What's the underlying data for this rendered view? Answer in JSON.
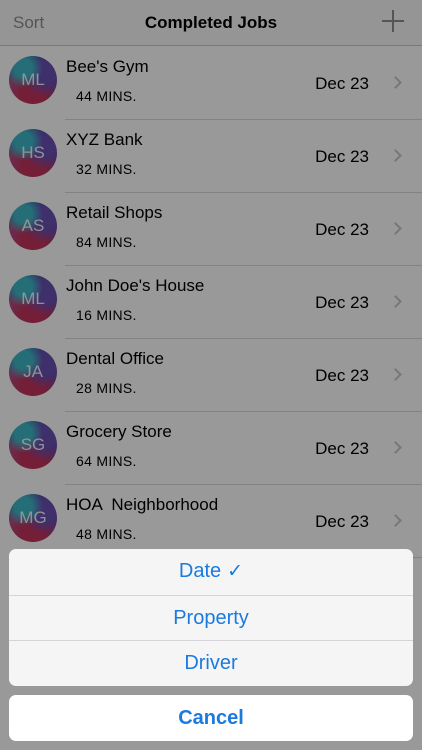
{
  "navbar": {
    "sort_label": "Sort",
    "title": "Completed Jobs",
    "add_icon": "plus-icon"
  },
  "jobs": [
    {
      "initials": "ML",
      "name": "Bee's Gym",
      "duration": "44 MINS.",
      "date": "Dec 23"
    },
    {
      "initials": "HS",
      "name": "XYZ Bank",
      "duration": "32 MINS.",
      "date": "Dec 23"
    },
    {
      "initials": "AS",
      "name": "Retail Shops",
      "duration": "84 MINS.",
      "date": "Dec 23"
    },
    {
      "initials": "ML",
      "name": "John Doe's House",
      "duration": "16 MINS.",
      "date": "Dec 23"
    },
    {
      "initials": "JA",
      "name": "Dental Office",
      "duration": "28 MINS.",
      "date": "Dec 23"
    },
    {
      "initials": "SG",
      "name": "Grocery Store",
      "duration": "64 MINS.",
      "date": "Dec 23"
    },
    {
      "initials": "MG",
      "name": "HOA  Neighborhood",
      "duration": "48 MINS.",
      "date": "Dec 23"
    }
  ],
  "sort_sheet": {
    "options": [
      {
        "label": "Date",
        "check": "✓"
      },
      {
        "label": "Property"
      },
      {
        "label": "Driver"
      }
    ],
    "cancel_label": "Cancel"
  },
  "colors": {
    "accent": "#1a7ae0",
    "nav_gray": "#8e8e93"
  }
}
